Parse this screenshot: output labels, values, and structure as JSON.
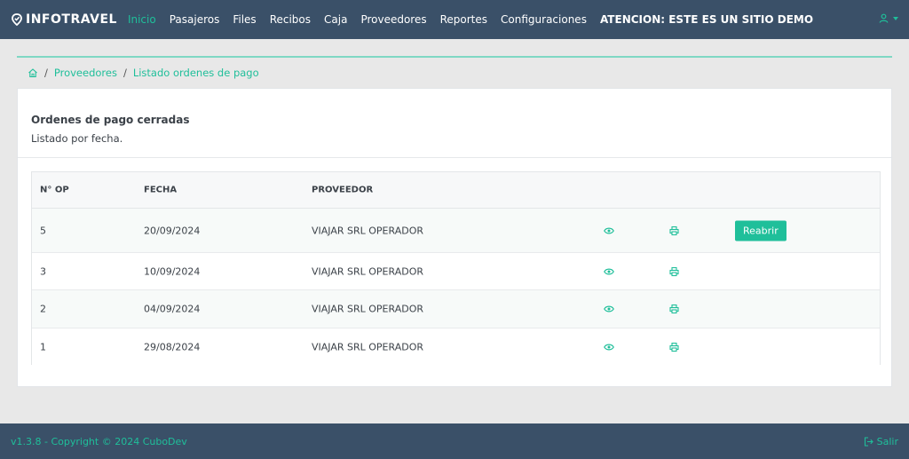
{
  "brand": {
    "name": "INFOTRAVEL"
  },
  "nav": {
    "items": [
      {
        "label": "Inicio",
        "active": true
      },
      {
        "label": "Pasajeros"
      },
      {
        "label": "Files"
      },
      {
        "label": "Recibos"
      },
      {
        "label": "Caja"
      },
      {
        "label": "Proveedores"
      },
      {
        "label": "Reportes"
      },
      {
        "label": "Configuraciones"
      }
    ],
    "warning": "ATENCION: ESTE ES UN SITIO DEMO"
  },
  "user": {
    "icon": "user-icon"
  },
  "breadcrumb": {
    "items": [
      "Proveedores",
      "Listado ordenes de pago"
    ],
    "home_icon": "home-icon"
  },
  "card": {
    "title": "Ordenes de pago cerradas",
    "subtitle": "Listado por fecha."
  },
  "table": {
    "headers": [
      "N° OP",
      "FECHA",
      "PROVEEDOR"
    ],
    "rows": [
      {
        "op": "5",
        "fecha": "20/09/2024",
        "proveedor": "VIAJAR SRL OPERADOR",
        "action": "Reabrir"
      },
      {
        "op": "3",
        "fecha": "10/09/2024",
        "proveedor": "VIAJAR SRL OPERADOR"
      },
      {
        "op": "2",
        "fecha": "04/09/2024",
        "proveedor": "VIAJAR SRL OPERADOR"
      },
      {
        "op": "1",
        "fecha": "29/08/2024",
        "proveedor": "VIAJAR SRL OPERADOR"
      }
    ]
  },
  "footer": {
    "copyright": "v1.3.8 - Copyright © 2024 CuboDev",
    "logout": "Salir"
  },
  "colors": {
    "accent": "#1fbf9a",
    "header_bg": "#3a5068",
    "page_bg": "#e8e8e8"
  }
}
